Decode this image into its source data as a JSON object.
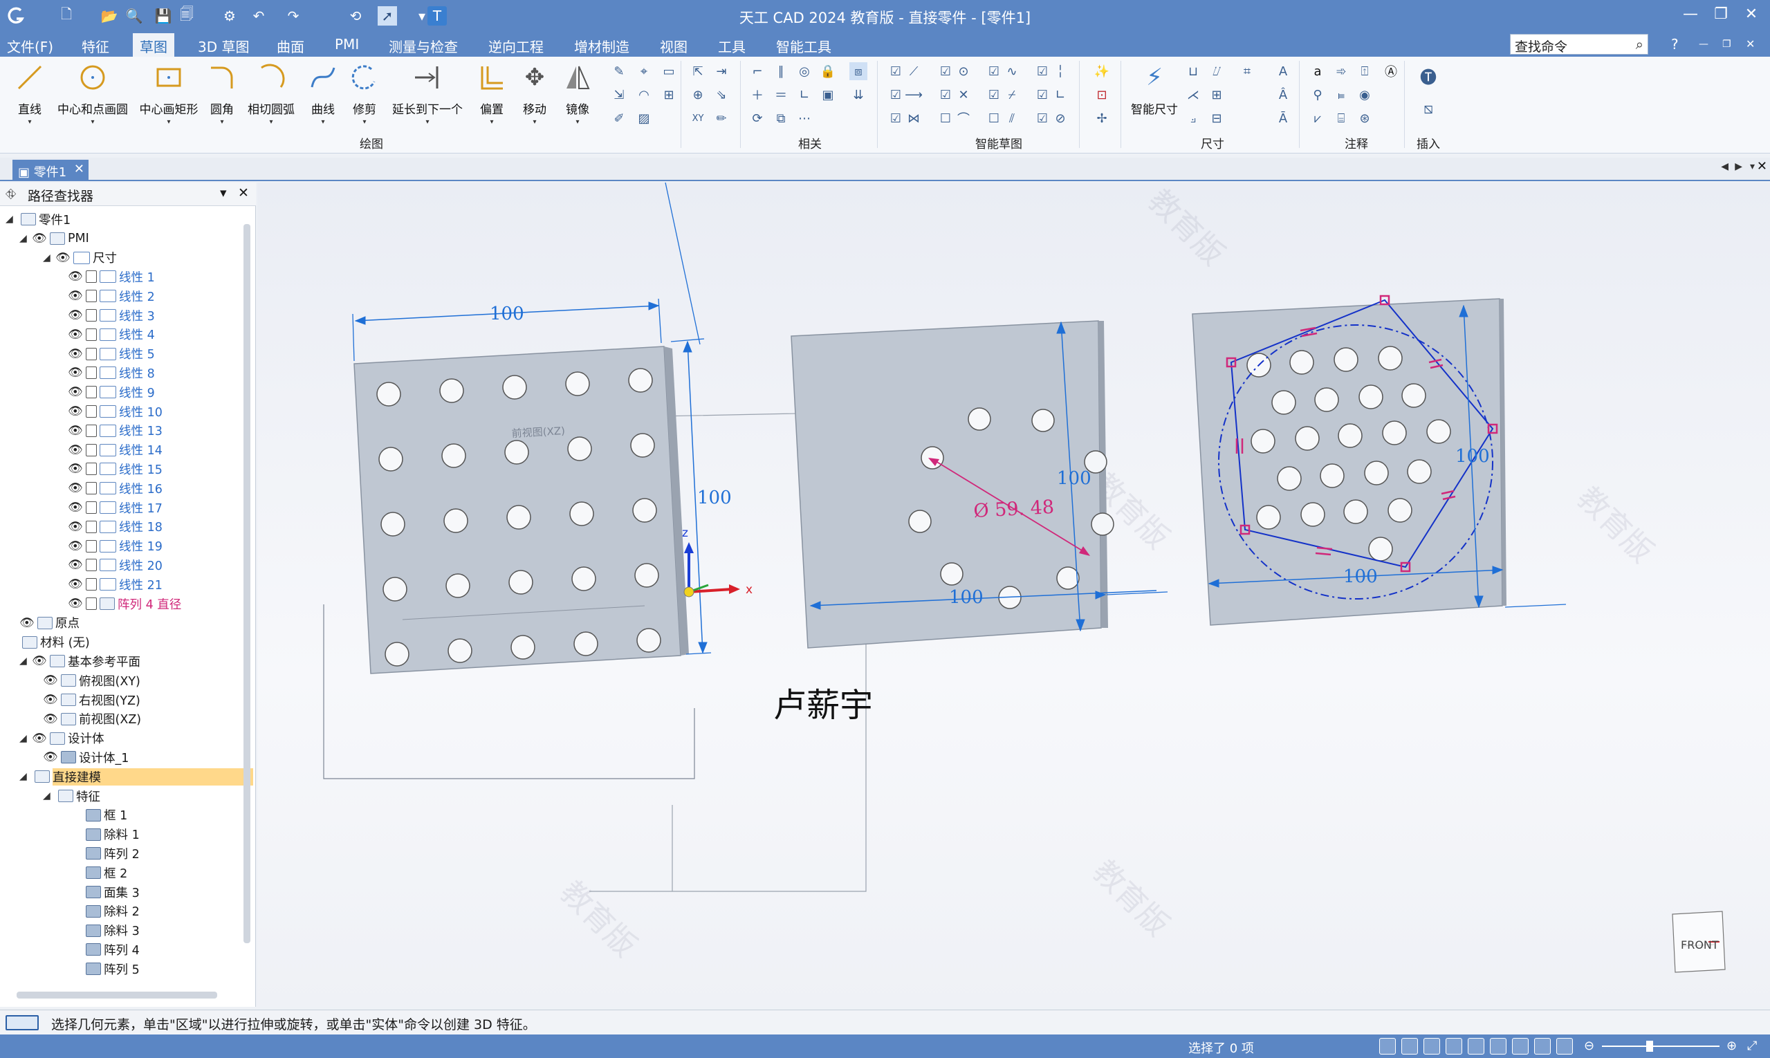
{
  "window": {
    "title": "天工 CAD 2024 教育版 - 直接零件 - [零件1]",
    "min": "—",
    "max": "❐",
    "close": "✕"
  },
  "menubar": {
    "file": "文件(F)",
    "items": [
      "特征",
      "草图",
      "3D 草图",
      "曲面",
      "PMI",
      "测量与检查",
      "逆向工程",
      "增材制造",
      "视图",
      "工具",
      "智能工具"
    ],
    "active": "草图"
  },
  "search": {
    "placeholder": "查找命令"
  },
  "ribbon": {
    "draw_tools": [
      "直线",
      "中心和点画圆",
      "中心画矩形",
      "圆角",
      "相切圆弧",
      "曲线",
      "修剪",
      "延长到下一个",
      "偏置",
      "移动",
      "镜像"
    ],
    "groups": {
      "draw": "绘图",
      "related": "相关",
      "smart_sketch": "智能草图",
      "dimension": "尺寸",
      "annotation": "注释",
      "insert": "插入"
    },
    "smart_dim": "智能尺寸",
    "insert": "插入"
  },
  "doc_tab": {
    "label": "零件1"
  },
  "pathfinder": {
    "title": "路径查找器",
    "root": "零件1",
    "pmi": "PMI",
    "dims_folder": "尺寸",
    "dims": [
      "线性 1",
      "线性 2",
      "线性 3",
      "线性 4",
      "线性 5",
      "线性 8",
      "线性 9",
      "线性 10",
      "线性 13",
      "线性 14",
      "线性 15",
      "线性 16",
      "线性 17",
      "线性 18",
      "线性 19",
      "线性 20",
      "线性 21"
    ],
    "array_dim": "阵列 4 直径",
    "origin": "原点",
    "material": "材料 (无)",
    "ref_planes": "基本参考平面",
    "planes": [
      "俯视图(XY)",
      "右视图(YZ)",
      "前视图(XZ)"
    ],
    "design_body": "设计体",
    "design_body_1": "设计体_1",
    "direct_modeling": "直接建模",
    "features_folder": "特征",
    "features": [
      "框 1",
      "除料 1",
      "阵列 2",
      "框 2",
      "面集 3",
      "除料 2",
      "除料 3",
      "阵列 4",
      "阵列 5"
    ]
  },
  "canvas": {
    "dim_100": "100",
    "diameter": "Ø 59. 48",
    "plane_label": "前视图(XZ)",
    "author": "卢薪宇",
    "axis_z": "z",
    "axis_x": "x",
    "view_cube": "FRONT",
    "watermark": "教育版"
  },
  "status": {
    "prompt": "选择几何元素，单击\"区域\"以进行拉伸或旋转，或单击\"实体\"命令以创建 3D 特征。",
    "selection": "选择了 0 项"
  },
  "colors": {
    "accent": "#5b86c4",
    "dim_blue": "#1f6fd6",
    "dim_red": "#d0287a",
    "plate": "#c9d0da"
  }
}
